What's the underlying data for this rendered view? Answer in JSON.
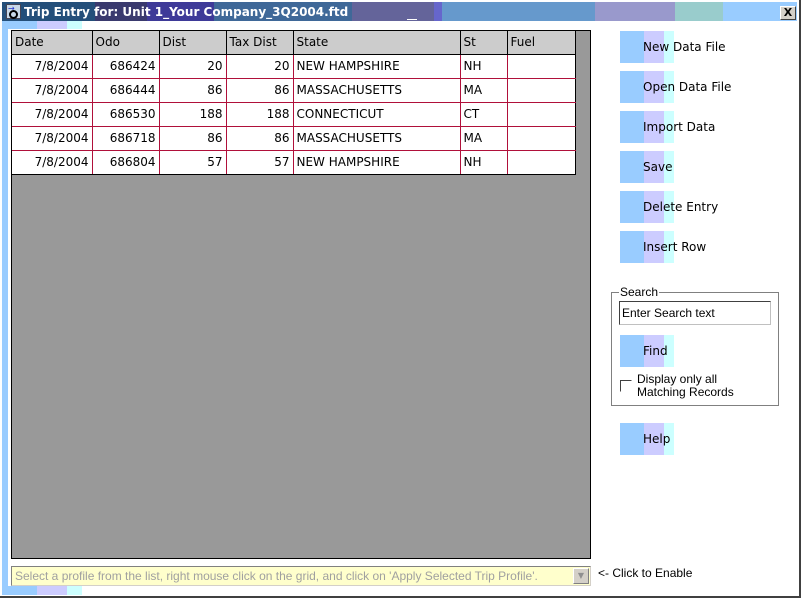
{
  "window": {
    "title": "Trip Entry for: Unit 1_Your Company_3Q2004.ftd",
    "close_label": "X"
  },
  "grid": {
    "columns": [
      "Date",
      "Odo",
      "Dist",
      "Tax Dist",
      "State",
      "St",
      "Fuel"
    ],
    "rows": [
      {
        "date": "7/8/2004",
        "odo": "686424",
        "dist": "20",
        "tax_dist": "20",
        "state": "NEW HAMPSHIRE",
        "st": "NH",
        "fuel": ""
      },
      {
        "date": "7/8/2004",
        "odo": "686444",
        "dist": "86",
        "tax_dist": "86",
        "state": "MASSACHUSETTS",
        "st": "MA",
        "fuel": ""
      },
      {
        "date": "7/8/2004",
        "odo": "686530",
        "dist": "188",
        "tax_dist": "188",
        "state": "CONNECTICUT",
        "st": "CT",
        "fuel": ""
      },
      {
        "date": "7/8/2004",
        "odo": "686718",
        "dist": "86",
        "tax_dist": "86",
        "state": "MASSACHUSETTS",
        "st": "MA",
        "fuel": ""
      },
      {
        "date": "7/8/2004",
        "odo": "686804",
        "dist": "57",
        "tax_dist": "57",
        "state": "NEW HAMPSHIRE",
        "st": "NH",
        "fuel": ""
      }
    ]
  },
  "sidebar": {
    "buttons": [
      {
        "label": "New Data File"
      },
      {
        "label": "Open Data File"
      },
      {
        "label": "Import Data"
      },
      {
        "label": "Save"
      },
      {
        "label": "Delete Entry"
      },
      {
        "label": "Insert Row"
      }
    ],
    "search": {
      "legend": "Search",
      "input_value": "Enter Search text",
      "find_label": "Find",
      "checkbox_label": "Display only all Matching Records",
      "checkbox_checked": false
    },
    "help_label": "Help"
  },
  "footer": {
    "profile_text": "Select a profile from the list, right mouse click on the grid, and click on 'Apply Selected Trip Profile'.",
    "enable_label": "<- Click to Enable"
  },
  "colors": {
    "grid_line": "#b0103a",
    "grid_background": "#999999",
    "header_background": "#cccccc",
    "profile_background": "#ffffcc"
  }
}
